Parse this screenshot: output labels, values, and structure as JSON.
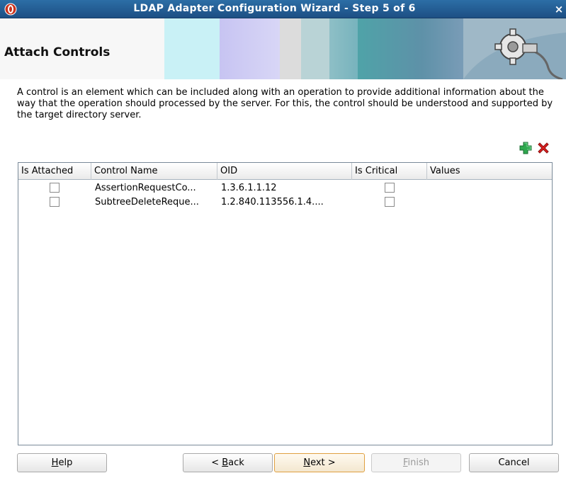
{
  "window": {
    "title": "LDAP Adapter Configuration Wizard - Step 5 of 6",
    "close_glyph": "×"
  },
  "banner": {
    "title": "Attach Controls"
  },
  "description": "A control is an element which can be included along with an operation to provide additional information about the way that the operation should processed by the server. For this, the control should be understood and supported by the target directory server.",
  "toolbar": {
    "add_icon": "add-icon",
    "delete_icon": "delete-icon",
    "add_color": "#2fa84f",
    "delete_color": "#e02020"
  },
  "table": {
    "columns": [
      "Is Attached",
      "Control Name",
      "OID",
      "Is Critical",
      "Values"
    ],
    "rows": [
      {
        "is_attached": false,
        "control_name": "AssertionRequestCo...",
        "oid": "1.3.6.1.1.12",
        "is_critical": false,
        "values": ""
      },
      {
        "is_attached": false,
        "control_name": "SubtreeDeleteReque...",
        "oid": "1.2.840.113556.1.4....",
        "is_critical": false,
        "values": ""
      }
    ]
  },
  "buttons": {
    "help": {
      "label_pre": "",
      "mnemonic": "H",
      "label_post": "elp"
    },
    "back": {
      "label_pre": "< ",
      "mnemonic": "B",
      "label_post": "ack"
    },
    "next": {
      "label_pre": "",
      "mnemonic": "N",
      "label_post": "ext >"
    },
    "finish": {
      "label_pre": "",
      "mnemonic": "F",
      "label_post": "inish"
    },
    "cancel": {
      "label_pre": "",
      "mnemonic": "",
      "label_post": "Cancel"
    }
  }
}
